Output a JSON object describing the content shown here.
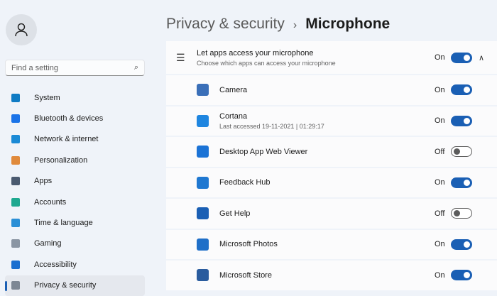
{
  "search": {
    "placeholder": "Find a setting"
  },
  "sidebar": {
    "items": [
      {
        "label": "System",
        "color": "#0f7bc4"
      },
      {
        "label": "Bluetooth & devices",
        "color": "#1a73e8"
      },
      {
        "label": "Network & internet",
        "color": "#1b8ad6"
      },
      {
        "label": "Personalization",
        "color": "#e08a3c"
      },
      {
        "label": "Apps",
        "color": "#4a5a70"
      },
      {
        "label": "Accounts",
        "color": "#1ea890"
      },
      {
        "label": "Time & language",
        "color": "#2b8fd6"
      },
      {
        "label": "Gaming",
        "color": "#8a95a3"
      },
      {
        "label": "Accessibility",
        "color": "#1a6fd0"
      },
      {
        "label": "Privacy & security",
        "color": "#7d8794"
      }
    ]
  },
  "breadcrumb": {
    "parent": "Privacy & security",
    "separator": "›",
    "current": "Microphone"
  },
  "master": {
    "title": "Let apps access your microphone",
    "subtitle": "Choose which apps can access your microphone",
    "state": "On"
  },
  "apps": [
    {
      "name": "Camera",
      "state": "On",
      "on": true
    },
    {
      "name": "Cortana",
      "sub": "Last accessed 19-11-2021  |  01:29:17",
      "state": "On",
      "on": true
    },
    {
      "name": "Desktop App Web Viewer",
      "state": "Off",
      "on": false
    },
    {
      "name": "Feedback Hub",
      "state": "On",
      "on": true
    },
    {
      "name": "Get Help",
      "state": "Off",
      "on": false
    },
    {
      "name": "Microsoft Photos",
      "state": "On",
      "on": true
    },
    {
      "name": "Microsoft Store",
      "state": "On",
      "on": true
    }
  ]
}
